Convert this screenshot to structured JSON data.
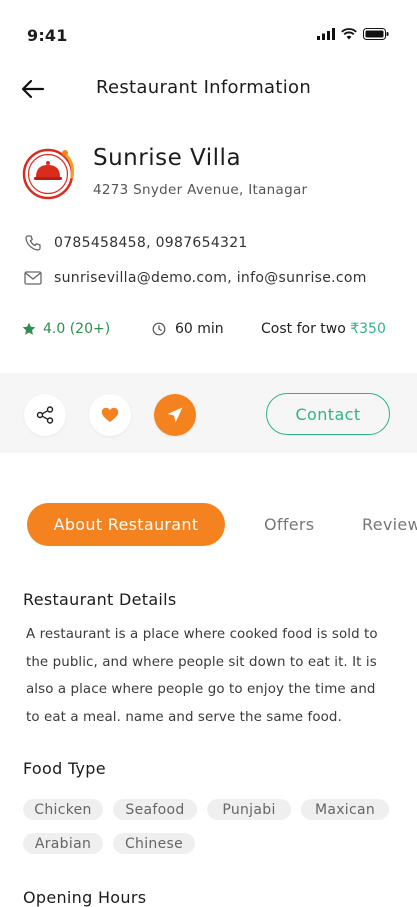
{
  "status_bar": {
    "time": "9:41"
  },
  "header": {
    "title": "Restaurant Information"
  },
  "restaurant": {
    "name": "Sunrise Villa",
    "address": "4273 Snyder Avenue, Itanagar",
    "phones": "0785458458, 0987654321",
    "emails": "sunrisevilla@demo.com, info@sunrise.com",
    "rating": "4.0 (20+)",
    "delivery_time": "60 min",
    "cost_label": "Cost for two",
    "cost_value": "₹350"
  },
  "actions": {
    "contact_label": "Contact"
  },
  "tabs": [
    {
      "label": "About Restaurant",
      "active": true
    },
    {
      "label": "Offers",
      "active": false
    },
    {
      "label": "Reviews",
      "active": false
    }
  ],
  "details": {
    "title": "Restaurant Details",
    "text": "A restaurant is a place where cooked food is sold to the public, and where people sit down to eat it. It is also a place where people go to enjoy the time and to eat a meal.  name and serve the same food."
  },
  "food_type": {
    "title": "Food Type",
    "chips": [
      "Chicken",
      "Seafood",
      "Punjabi",
      "Maxican",
      "Arabian",
      "Chinese"
    ]
  },
  "opening_hours": {
    "title": "Opening Hours"
  },
  "colors": {
    "accent": "#f4821f",
    "green": "#2fb38a",
    "rating_green": "#2e8f4e"
  }
}
